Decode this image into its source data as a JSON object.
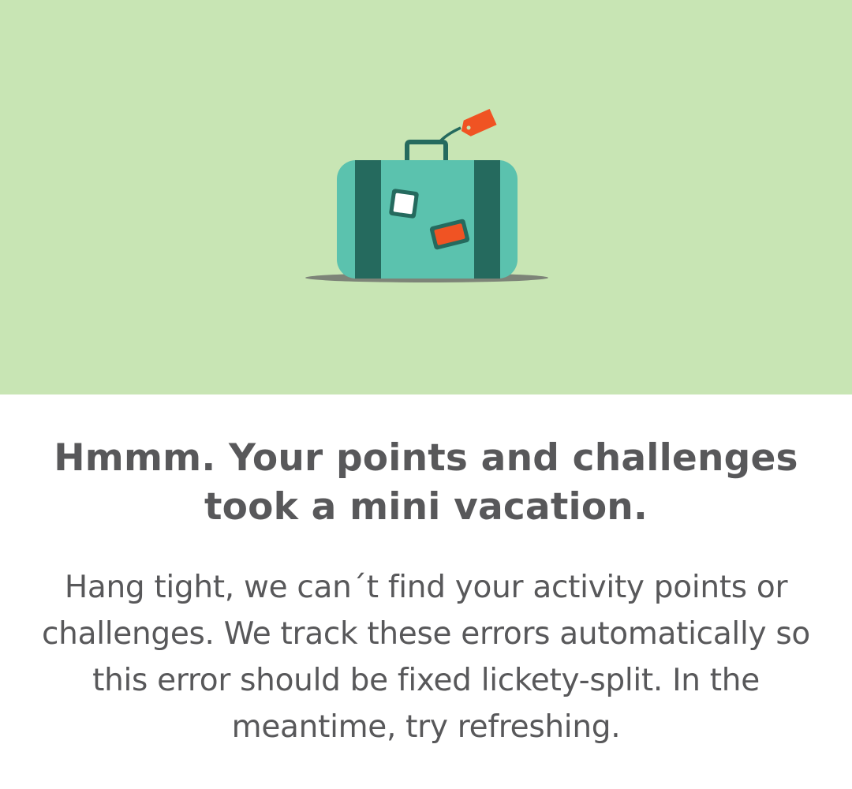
{
  "illustration": {
    "icon": "suitcase-icon",
    "colors": {
      "background": "#c8e5b4",
      "suitcase_body": "#5bc2ae",
      "suitcase_straps": "#256a5e",
      "tag": "#f05323",
      "sticker_white": "#ffffff",
      "shadow": "#7d8478"
    }
  },
  "error": {
    "title_line1": "Hmmm. Your points and challenges",
    "title_line2": "took a mini vacation.",
    "message_line1": "Hang tight, we can´t find your activity points or",
    "message_line2": "challenges. We track these errors automatically so",
    "message_line3": "this error should be fixed lickety-split. In the",
    "message_line4": "meantime, try refreshing."
  },
  "colors": {
    "text": "#58585a",
    "page_background": "#ffffff"
  }
}
